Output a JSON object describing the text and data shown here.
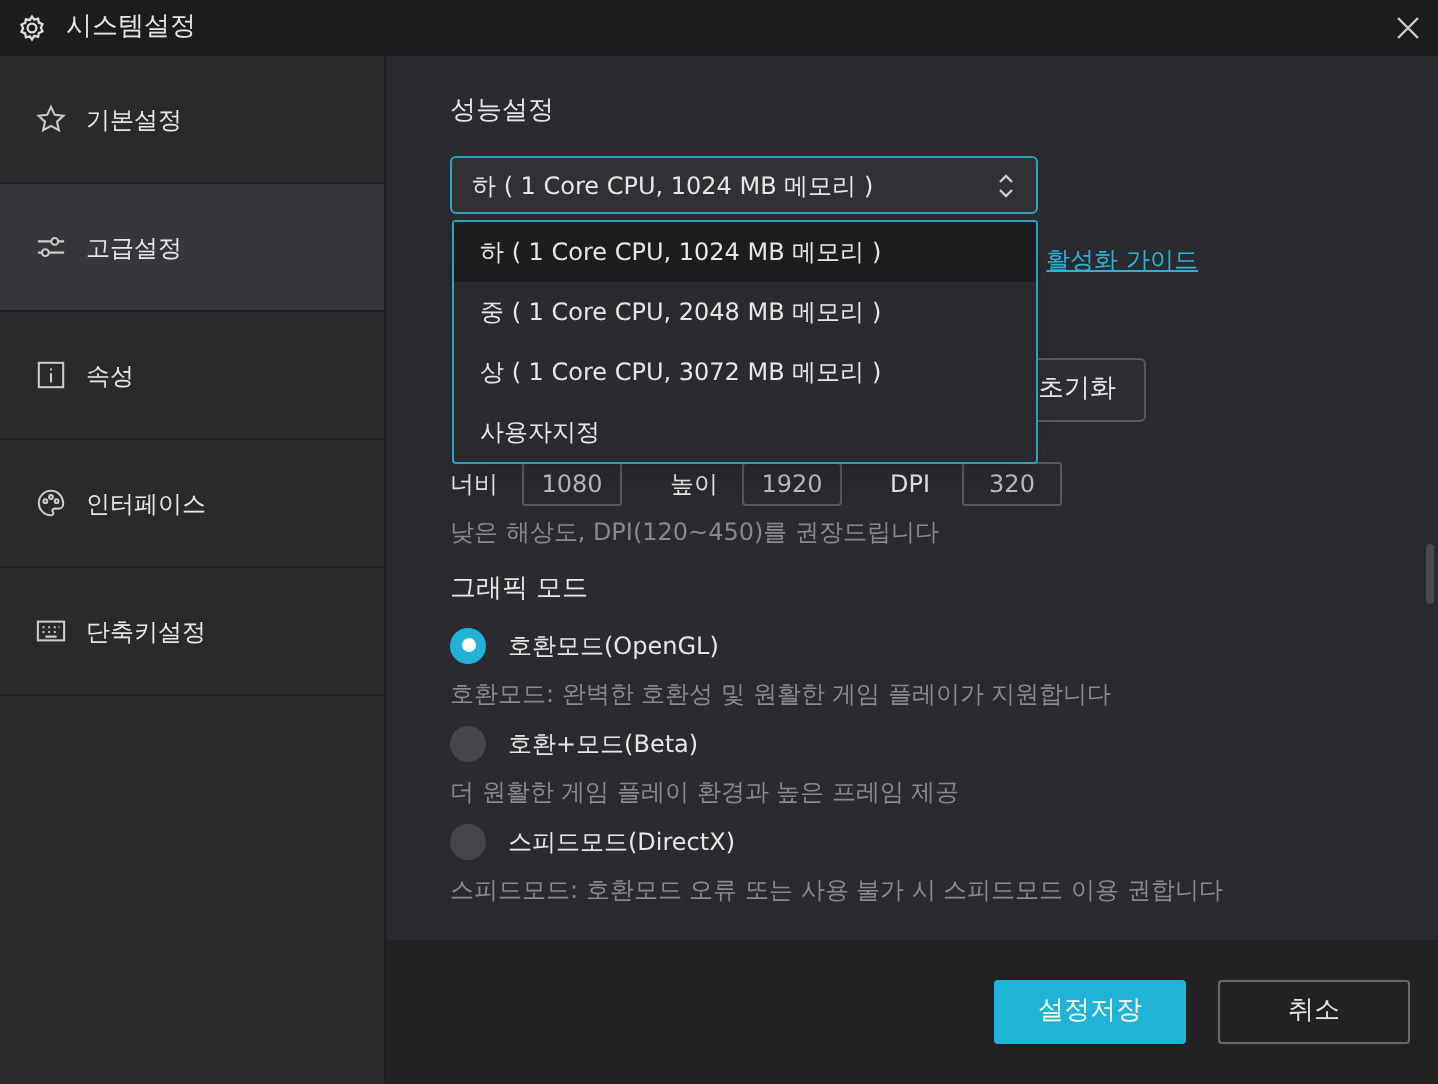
{
  "window": {
    "title": "시스템설정"
  },
  "sidebar": {
    "items": [
      {
        "label": "기본설정",
        "selected": false
      },
      {
        "label": "고급설정",
        "selected": true
      },
      {
        "label": "속성",
        "selected": false
      },
      {
        "label": "인터페이스",
        "selected": false
      },
      {
        "label": "단축키설정",
        "selected": false
      }
    ]
  },
  "performance": {
    "heading": "성능설정",
    "select_value": "하 ( 1 Core CPU, 1024 MB 메모리 )",
    "expanded": true,
    "options": [
      {
        "label": "하 ( 1 Core CPU, 1024 MB 메모리 )",
        "selected": true
      },
      {
        "label": "중 ( 1 Core CPU, 2048 MB 메모리 )",
        "selected": false
      },
      {
        "label": "상 ( 1 Core CPU, 3072 MB 메모리 )",
        "selected": false
      },
      {
        "label": "사용자지정",
        "selected": false
      }
    ],
    "guide_link": "활성화 가이드",
    "reset_button": "초기화"
  },
  "resolution": {
    "fields": [
      {
        "label": "너비",
        "value": "1080"
      },
      {
        "label": "높이",
        "value": "1920"
      },
      {
        "label": "DPI",
        "value": "320"
      }
    ],
    "hint": "낮은 해상도, DPI(120~450)를 권장드립니다"
  },
  "graphics": {
    "heading": "그래픽 모드",
    "modes": [
      {
        "label": "호환모드(OpenGL)",
        "description": "호환모드: 완벽한 호환성 및 원활한 게임 플레이가 지원합니다",
        "selected": true
      },
      {
        "label": "호환+모드(Beta)",
        "description": "더 원활한 게임 플레이 환경과 높은 프레임 제공",
        "selected": false
      },
      {
        "label": "스피드모드(DirectX)",
        "description": "스피드모드: 호환모드 오류 또는 사용 불가 시 스피드모드 이용 권합니다",
        "selected": false
      }
    ]
  },
  "footer": {
    "buttons": [
      {
        "label": "설정저장",
        "kind": "primary"
      },
      {
        "label": "취소",
        "kind": "secondary"
      }
    ]
  }
}
